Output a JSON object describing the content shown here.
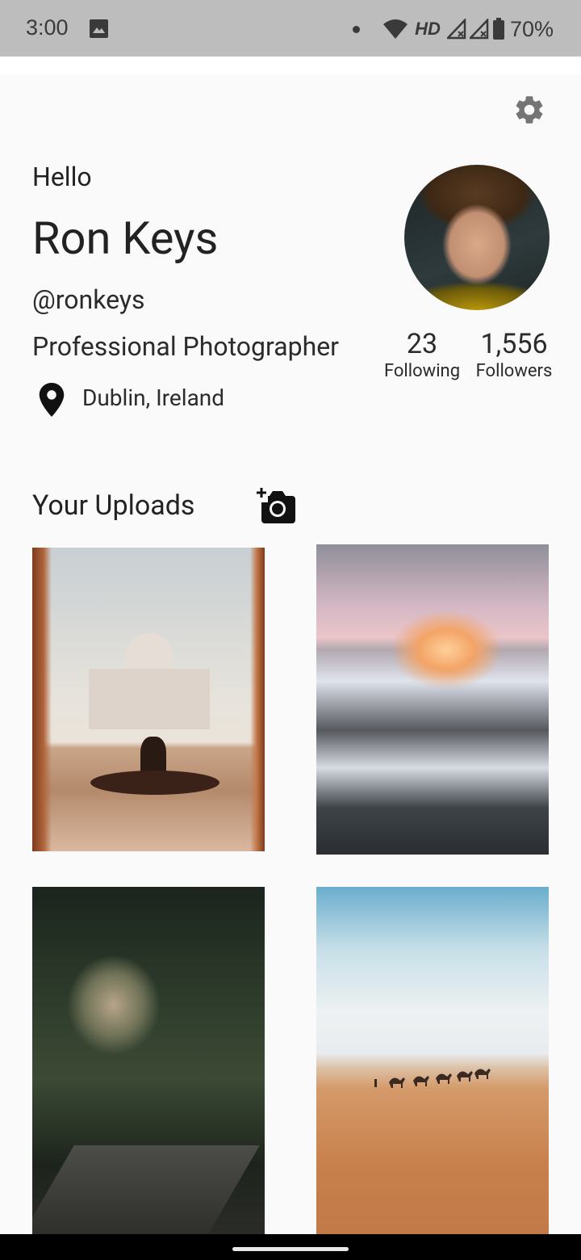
{
  "status_bar": {
    "time": "3:00",
    "network": "HD",
    "battery": "70%"
  },
  "profile": {
    "greeting": "Hello",
    "name": "Ron Keys",
    "handle": "@ronkeys",
    "title": "Professional Photographer",
    "location": "Dublin, Ireland",
    "stats": {
      "following_count": "23",
      "following_label": "Following",
      "followers_count": "1,556",
      "followers_label": "Followers"
    }
  },
  "uploads": {
    "title": "Your Uploads",
    "photos": [
      {
        "name": "taj-mahal-photo"
      },
      {
        "name": "snowy-forest-sunset-photo"
      },
      {
        "name": "forest-road-photo"
      },
      {
        "name": "desert-camels-photo"
      }
    ]
  },
  "icons": {
    "settings": "gear-icon",
    "location": "location-pin-icon",
    "add_photo": "add-photo-icon"
  }
}
